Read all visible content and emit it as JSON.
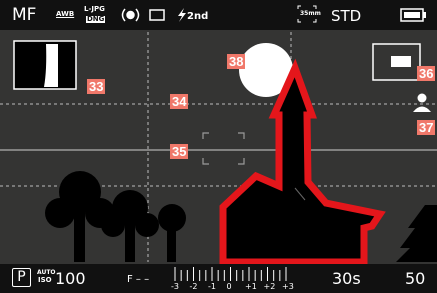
{
  "top_bar": {
    "focus_mode": "MF",
    "white_balance": "AWB",
    "file_format_top": "L-JPG",
    "file_format_bottom": "DNG",
    "metering_icon": "spot-metering-icon",
    "drive_icon": "single-frame-icon",
    "flash_label": "2nd",
    "focal_length": "35mm",
    "film_style": "STD",
    "battery_icon": "battery-icon"
  },
  "callouts": {
    "c33": "33",
    "c34": "34",
    "c35": "35",
    "c36": "36",
    "c37": "37",
    "c38": "38"
  },
  "bottom_bar": {
    "exposure_mode": "P",
    "iso_auto": "AUTO",
    "iso_label": "ISO",
    "iso_value": "100",
    "aperture": "F – –",
    "scale_labels": [
      "-3",
      "-2",
      "-1",
      "0",
      "+1",
      "+2",
      "+3"
    ],
    "shutter": "30s",
    "shots_remaining": "50"
  },
  "colors": {
    "screen_bg": "#343433",
    "bar_bg": "#111111",
    "warning_red": "#e4161b",
    "callout": "#f0786a"
  }
}
